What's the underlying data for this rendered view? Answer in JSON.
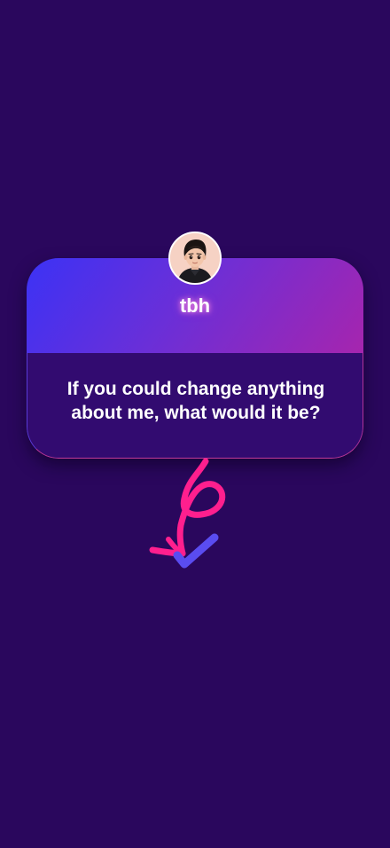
{
  "card": {
    "title": "tbh",
    "question": "If you could change anything about me, what would it be?"
  },
  "avatar": {
    "icon": "avatar-boy-illustration"
  },
  "doodle": {
    "icons": [
      "squiggle-arrow-icon",
      "checkmark-icon"
    ],
    "colors": {
      "arrow": "#ff1f8e",
      "check": "#5a4cf0"
    }
  },
  "colors": {
    "background": "#2a075d",
    "card_body": "#320b70",
    "gradient_start": "#3c32f5",
    "gradient_end": "#a625ae"
  }
}
